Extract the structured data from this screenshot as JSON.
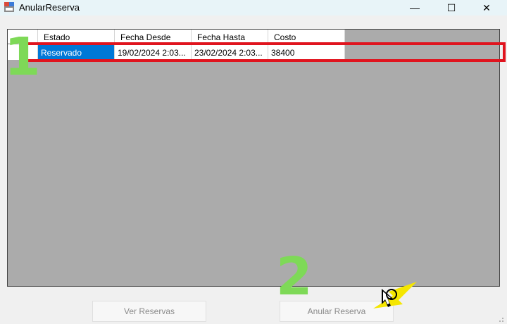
{
  "window": {
    "title": "AnularReserva",
    "minimize_glyph": "—",
    "maximize_glyph": "☐",
    "close_glyph": "✕",
    "icon": "app-form-icon"
  },
  "grid": {
    "columns": [
      "Estado",
      "Fecha Desde",
      "Fecha Hasta",
      "Costo"
    ],
    "rows": [
      {
        "estado": "Reservado",
        "fecha_desde": "19/02/2024 2:03...",
        "fecha_hasta": "23/02/2024 2:03...",
        "costo": "38400"
      }
    ]
  },
  "annotations": {
    "step1": "1",
    "step2": "2",
    "highlight_color": "#e0141e",
    "number_color": "#7ed957",
    "cursor_color": "#f5e600"
  },
  "buttons": {
    "ver_reservas": "Ver Reservas",
    "anular_reserva": "Anular Reserva"
  }
}
